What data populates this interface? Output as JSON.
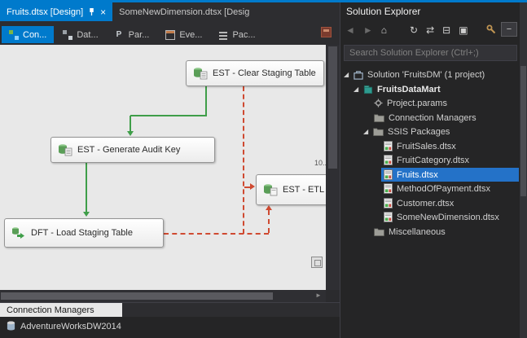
{
  "document_tabs": {
    "active": "Fruits.dtsx [Design]",
    "inactive": "SomeNewDimension.dtsx [Desig"
  },
  "designer_tabs": [
    "Con...",
    "Dat...",
    "Par...",
    "Eve...",
    "Pac..."
  ],
  "canvas": {
    "tasks": [
      "EST - Clear Staging Table",
      "EST - Generate Audit Key",
      "EST - ETL",
      "DFT - Load Staging Table"
    ],
    "annotation": "10..."
  },
  "bottom_panel": {
    "tab": "Connection Managers",
    "connection": "AdventureWorksDW2014"
  },
  "solution_explorer": {
    "title": "Solution Explorer",
    "search_placeholder": "Search Solution Explorer (Ctrl+;)",
    "tree": [
      "Solution 'FruitsDM' (1 project)",
      "FruitsDataMart",
      "Project.params",
      "Connection Managers",
      "SSIS Packages",
      "FruitSales.dtsx",
      "FruitCategory.dtsx",
      "Fruits.dtsx",
      "MethodOfPayment.dtsx",
      "Customer.dtsx",
      "SomeNewDimension.dtsx",
      "Miscellaneous"
    ]
  },
  "icons": {
    "expanded_glyph": "◢",
    "back": "◄",
    "forward": "►",
    "home": "⌂",
    "sync": "↻",
    "refresh": "⇄",
    "collapse_all": "⊟",
    "show_all": "▣",
    "close": "×",
    "minus": "−",
    "hscroll_arrow": "►"
  },
  "colors": {
    "accent": "#007acc",
    "selection": "#2472c8",
    "success_path": "#3f9e49",
    "failure_path": "#cf4a31"
  }
}
